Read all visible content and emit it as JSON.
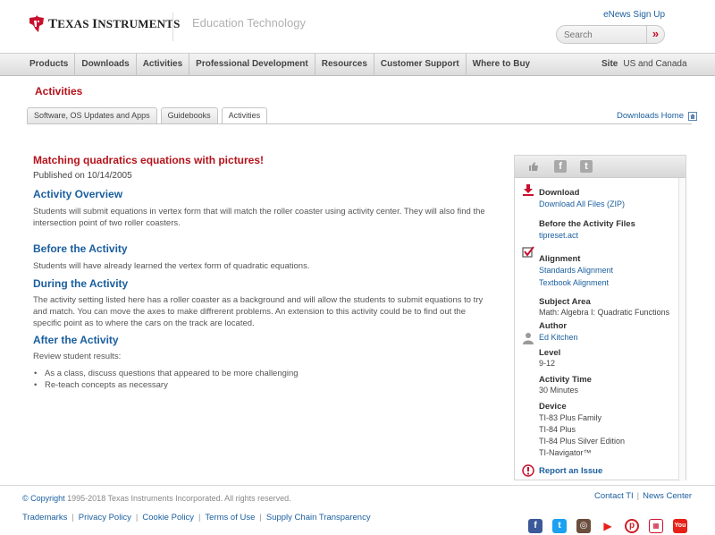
{
  "header": {
    "logo_text_1": "T",
    "logo_text_2": "EXAS ",
    "logo_text_3": "I",
    "logo_text_4": "NSTRUMENTS",
    "division": "Education Technology",
    "enews": "eNews Sign Up",
    "search_placeholder": "Search",
    "search_go": "»"
  },
  "nav": {
    "items": [
      "Products",
      "Downloads",
      "Activities",
      "Professional Development",
      "Resources",
      "Customer Support",
      "Where to Buy"
    ],
    "site_label": "Site",
    "site_value": "US and Canada"
  },
  "section_title": "Activities",
  "tabs": [
    "Software, OS Updates and Apps",
    "Guidebooks",
    "Activities"
  ],
  "active_tab": 2,
  "downloads_home": "Downloads Home",
  "main": {
    "title": "Matching quadratics equations with pictures!",
    "published": "Published on 10/14/2005",
    "overview_h": "Activity Overview",
    "overview_p": "Students will submit equations in vertex form that will match the roller coaster using activity center. They will also find the intersection point of two roller coasters.",
    "before_h": "Before the Activity",
    "before_p": "Students will have already learned the vertex form of quadratic equations.",
    "during_h": "During the Activity",
    "during_p": "The activity setting listed here has a roller coaster as a background and will allow the students to submit equations to try and match. You can move the axes to make diffrerent problems. An extension to this activity could be to find out the specific point as to where the cars on the track are located.",
    "after_h": "After the Activity",
    "after_p": "Review student results:",
    "after_list": [
      "As a class, discuss questions that appeared to be more challenging",
      "Re-teach concepts as necessary"
    ]
  },
  "sidebar": {
    "download_h": "Download",
    "download_all": "Download All Files (ZIP)",
    "before_files_h": "Before the Activity Files",
    "before_file": "tipreset.act",
    "alignment_h": "Alignment",
    "standards": "Standards Alignment",
    "textbook": "Textbook Alignment",
    "subject_h": "Subject Area",
    "subject_v": "Math: Algebra I: Quadratic Functions",
    "author_h": "Author",
    "author_v": "Ed Kitchen",
    "level_h": "Level",
    "level_v": "9-12",
    "time_h": "Activity Time",
    "time_v": "30 Minutes",
    "device_h": "Device",
    "devices": [
      "TI-83 Plus Family",
      "TI-84 Plus",
      "TI-84 Plus Silver Edition",
      "TI-Navigator™"
    ],
    "report": "Report an Issue"
  },
  "footer": {
    "copyright_link": "© Copyright",
    "copyright_text": " 1995-2018 Texas Instruments Incorporated. All rights reserved.",
    "contact": "Contact TI",
    "news": "News Center",
    "links": [
      "Trademarks",
      "Privacy Policy",
      "Cookie Policy",
      "Terms of Use",
      "Supply Chain Transparency"
    ]
  },
  "colors": {
    "accent_red": "#b5121b",
    "link_blue": "#1a5e9e"
  }
}
